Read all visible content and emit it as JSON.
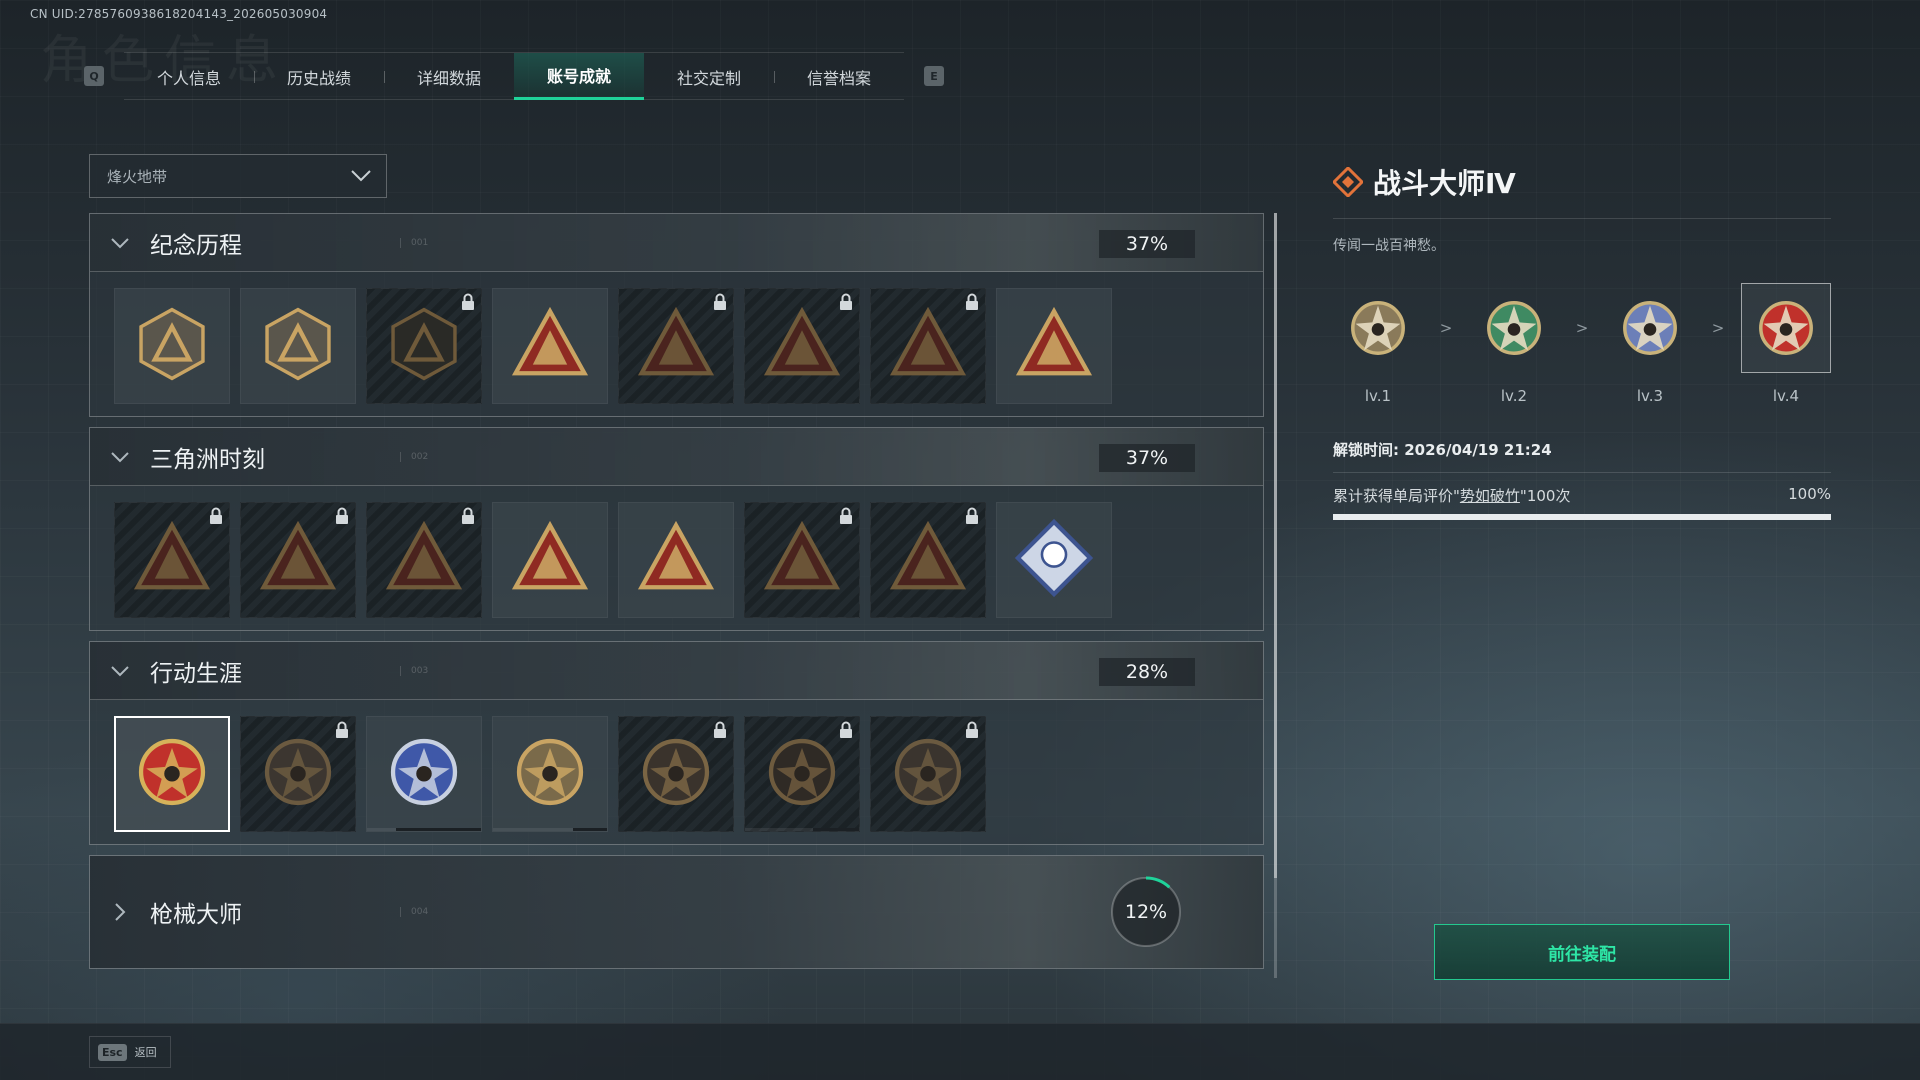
{
  "uid_text": "CN UID:2785760938618204143_202605030904",
  "bg_title": "角色信息",
  "tabbar": {
    "prev_key": "Q",
    "next_key": "E",
    "tabs": [
      {
        "label": "个人信息"
      },
      {
        "label": "历史战绩"
      },
      {
        "label": "详细数据"
      },
      {
        "label": "账号成就",
        "active": true
      },
      {
        "label": "社交定制"
      },
      {
        "label": "信誉档案"
      }
    ]
  },
  "mode_dropdown": {
    "value": "烽火地带"
  },
  "categories": [
    {
      "title": "纪念历程",
      "index": "001",
      "percent": "37%",
      "expanded": true,
      "medals": [
        {
          "name": "mountain-triangle",
          "locked": false
        },
        {
          "name": "helicopter",
          "locked": false
        },
        {
          "name": "hex-emblem",
          "locked": true
        },
        {
          "name": "vehicle-58",
          "locked": false
        },
        {
          "name": "tower-58",
          "locked": true
        },
        {
          "name": "hooded-figure",
          "locked": true
        },
        {
          "name": "soldier-crossed-guns",
          "locked": true
        },
        {
          "name": "golden-hand",
          "locked": false
        }
      ]
    },
    {
      "title": "三角洲时刻",
      "index": "002",
      "percent": "37%",
      "expanded": true,
      "medals": [
        {
          "name": "bottle",
          "locked": true
        },
        {
          "name": "backpack",
          "locked": true
        },
        {
          "name": "crouching-soldier",
          "locked": true
        },
        {
          "name": "dice",
          "locked": false
        },
        {
          "name": "running-soldiers",
          "locked": false
        },
        {
          "name": "squad",
          "locked": true
        },
        {
          "name": "dolphin",
          "locked": true
        },
        {
          "name": "rose-diamond",
          "locked": false
        }
      ]
    },
    {
      "title": "行动生涯",
      "index": "003",
      "percent": "28%",
      "expanded": true,
      "medals": [
        {
          "name": "star-eagle-gold",
          "locked": false,
          "selected": true
        },
        {
          "name": "shield-chevron",
          "locked": true
        },
        {
          "name": "blue-shield-stars",
          "locked": false,
          "progress": 0.75
        },
        {
          "name": "dice-shield",
          "locked": false,
          "progress": 0.3
        },
        {
          "name": "round-seal",
          "locked": true
        },
        {
          "name": "skull-target",
          "locked": true,
          "progress": 0.4
        },
        {
          "name": "eye-seal",
          "locked": true
        }
      ]
    },
    {
      "title": "枪械大师",
      "index": "004",
      "percent": "12%",
      "expanded": false,
      "progress": 0.12
    }
  ],
  "detail": {
    "title": "战斗大师Ⅳ",
    "description": "传闻一战百神愁。",
    "levels": [
      {
        "label": "lv.1",
        "color": "#8a7a5a"
      },
      {
        "label": "lv.2",
        "color": "#3f8a62"
      },
      {
        "label": "lv.3",
        "color": "#6c7fb8"
      },
      {
        "label": "lv.4",
        "color": "#c0312b",
        "current": true
      }
    ],
    "level_arrow": ">",
    "unlock_time": "解锁时间: 2026/04/19 21:24",
    "requirement": {
      "prefix": "累计获得单局评价\"",
      "keyword": "势如破竹",
      "suffix": "\"100次",
      "percent": "100%",
      "progress": 1.0
    }
  },
  "equip_button": "前往装配",
  "esc": {
    "key": "Esc",
    "label": "返回"
  },
  "colors": {
    "accent": "#1fd39a",
    "button_text": "#2ee6a6",
    "title_icon": "#e2733a"
  }
}
